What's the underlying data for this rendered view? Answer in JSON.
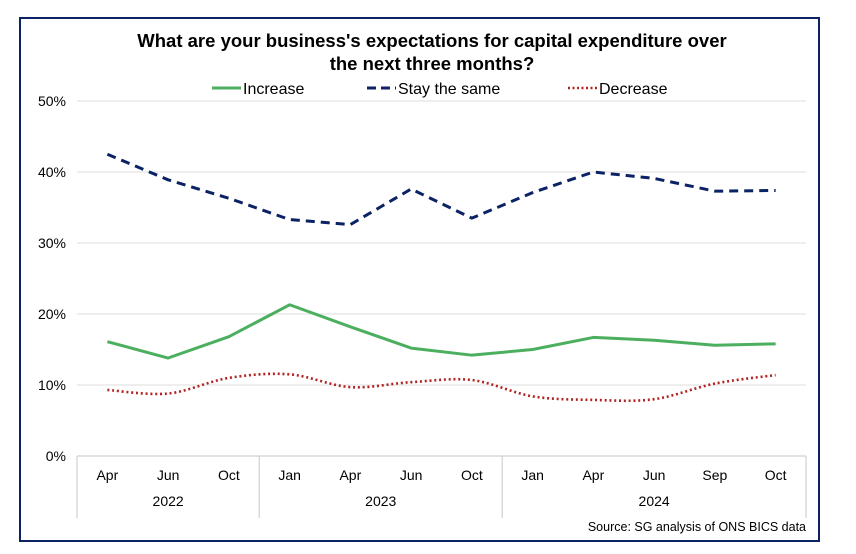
{
  "chart_data": {
    "type": "line",
    "title": [
      "What are your business's expectations for capital expenditure over",
      "the next three months?"
    ],
    "xlabel": "",
    "ylabel": "",
    "ylim": [
      0,
      0.5
    ],
    "yticks": [
      0,
      0.1,
      0.2,
      0.3,
      0.4,
      0.5
    ],
    "ytick_labels": [
      "0%",
      "10%",
      "20%",
      "30%",
      "40%",
      "50%"
    ],
    "grid": true,
    "legend_position": "top",
    "categories": [
      "Apr",
      "Jun",
      "Oct",
      "Jan",
      "Apr",
      "Jun",
      "Oct",
      "Jan",
      "Apr",
      "Jun",
      "Sep",
      "Oct"
    ],
    "category_groups": [
      {
        "label": "2022",
        "count": 3
      },
      {
        "label": "2023",
        "count": 4
      },
      {
        "label": "2024",
        "count": 5
      }
    ],
    "series": [
      {
        "name": "Increase",
        "color": "#4caf5f",
        "style": "solid",
        "values": [
          0.161,
          0.138,
          0.168,
          0.213,
          0.182,
          0.152,
          0.142,
          0.15,
          0.167,
          0.163,
          0.156,
          0.158
        ]
      },
      {
        "name": "Stay the same",
        "color": "#0b2265",
        "style": "dashed",
        "values": [
          0.425,
          0.389,
          0.363,
          0.333,
          0.326,
          0.376,
          0.335,
          0.371,
          0.4,
          0.391,
          0.373,
          0.374
        ]
      },
      {
        "name": "Decrease",
        "color": "#b22222",
        "style": "dotted",
        "values": [
          0.093,
          0.088,
          0.11,
          0.115,
          0.097,
          0.104,
          0.107,
          0.084,
          0.079,
          0.08,
          0.102,
          0.114
        ]
      }
    ],
    "source": "Source: SG analysis of ONS BICS data"
  }
}
